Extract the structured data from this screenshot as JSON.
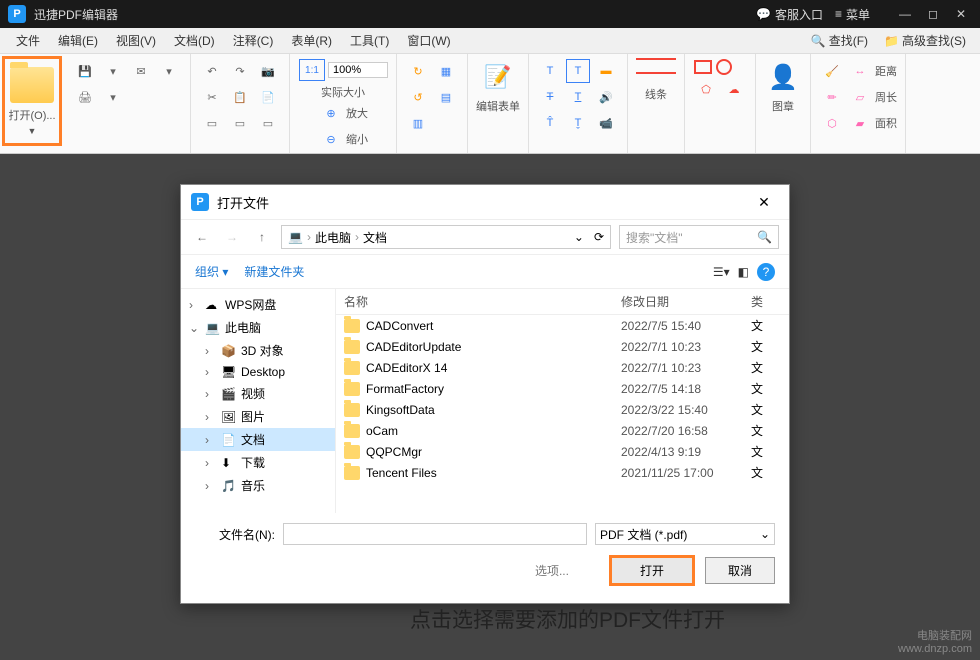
{
  "app": {
    "title": "迅捷PDF编辑器"
  },
  "titlebar": {
    "help": "客服入口",
    "menu": "菜单"
  },
  "menu": {
    "items": [
      "文件",
      "编辑(E)",
      "视图(V)",
      "文档(D)",
      "注释(C)",
      "表单(R)",
      "工具(T)",
      "窗口(W)"
    ],
    "find": "查找(F)",
    "advfind": "高级查找(S)"
  },
  "toolbar": {
    "open": "打开(O)...",
    "zoom": "100%",
    "actual": "实际大小",
    "zoomin": "放大",
    "zoomout": "缩小",
    "editform": "编辑表单",
    "lines": "线条",
    "image": "图章",
    "distance": "距离",
    "perimeter": "周长",
    "area": "面积"
  },
  "dialog": {
    "title": "打开文件",
    "crumb": {
      "root": "此电脑",
      "folder": "文档"
    },
    "search_ph": "搜索\"文档\"",
    "organize": "组织",
    "newfolder": "新建文件夹",
    "headers": {
      "name": "名称",
      "date": "修改日期",
      "type": "类"
    },
    "tree": [
      {
        "label": "WPS网盘",
        "icon": "cloud",
        "chev": ">"
      },
      {
        "label": "此电脑",
        "icon": "pc",
        "chev": "v",
        "bold": true
      },
      {
        "label": "3D 对象",
        "icon": "3d",
        "indent": 1,
        "chev": ">"
      },
      {
        "label": "Desktop",
        "icon": "desktop",
        "indent": 1,
        "chev": ">"
      },
      {
        "label": "视频",
        "icon": "video",
        "indent": 1,
        "chev": ">"
      },
      {
        "label": "图片",
        "icon": "pic",
        "indent": 1,
        "chev": ">"
      },
      {
        "label": "文档",
        "icon": "doc",
        "indent": 1,
        "chev": ">",
        "sel": true
      },
      {
        "label": "下载",
        "icon": "dl",
        "indent": 1,
        "chev": ">"
      },
      {
        "label": "音乐",
        "icon": "music",
        "indent": 1,
        "chev": ">"
      }
    ],
    "files": [
      {
        "name": "CADConvert",
        "date": "2022/7/5 15:40",
        "type": "文"
      },
      {
        "name": "CADEditorUpdate",
        "date": "2022/7/1 10:23",
        "type": "文"
      },
      {
        "name": "CADEditorX 14",
        "date": "2022/7/1 10:23",
        "type": "文"
      },
      {
        "name": "FormatFactory",
        "date": "2022/7/5 14:18",
        "type": "文"
      },
      {
        "name": "KingsoftData",
        "date": "2022/3/22 15:40",
        "type": "文"
      },
      {
        "name": "oCam",
        "date": "2022/7/20 16:58",
        "type": "文"
      },
      {
        "name": "QQPCMgr",
        "date": "2022/4/13 9:19",
        "type": "文"
      },
      {
        "name": "Tencent Files",
        "date": "2021/11/25 17:00",
        "type": "文"
      }
    ],
    "filename_label": "文件名(N):",
    "filter": "PDF 文档 (*.pdf)",
    "options": "选项...",
    "open": "打开",
    "cancel": "取消"
  },
  "caption": "点击选择需要添加的PDF文件打开",
  "watermark": {
    "l1": "电脑装配网",
    "l2": "www.dnzp.com"
  }
}
